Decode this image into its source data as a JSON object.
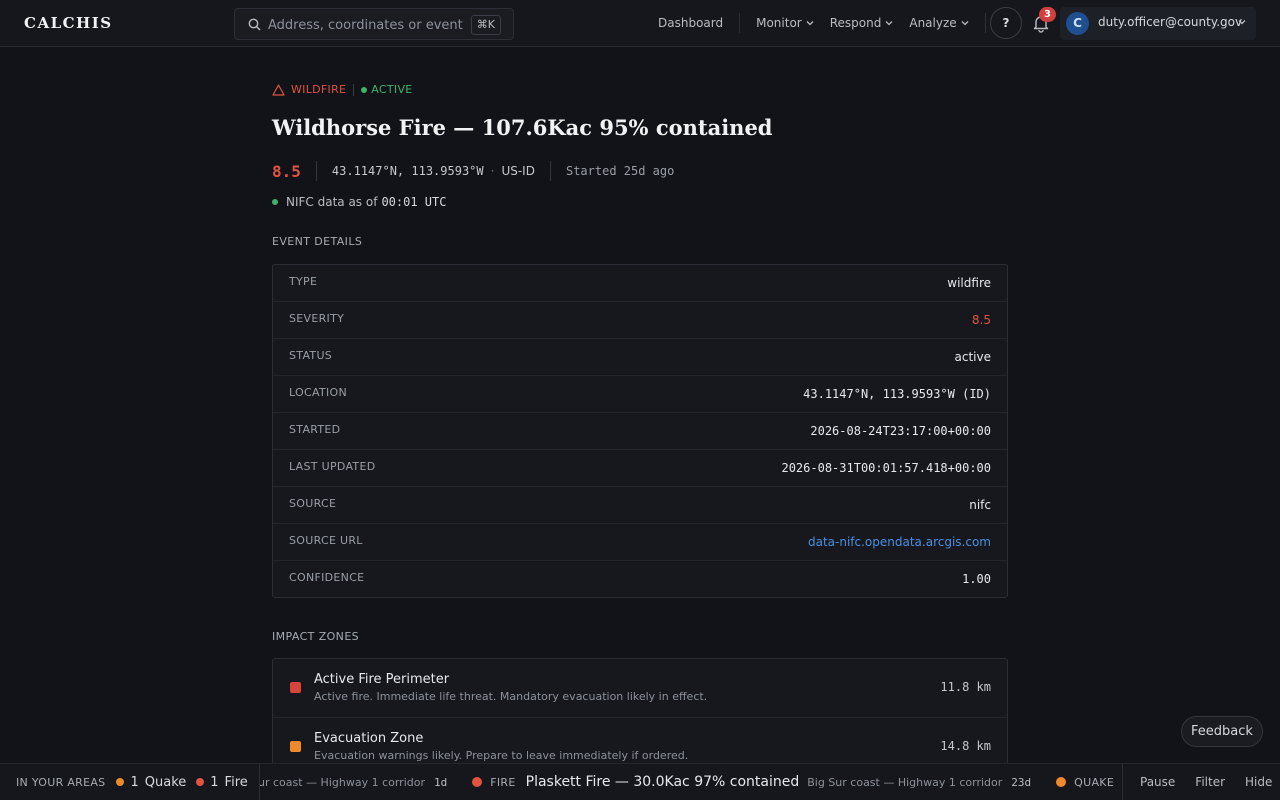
{
  "header": {
    "brand": "CALCHIS",
    "search": {
      "placeholder": "Address, coordinates or event",
      "shortcut": "⌘K"
    },
    "nav": [
      {
        "label": "Dashboard",
        "dropdown": false
      },
      {
        "label": "Monitor",
        "dropdown": true
      },
      {
        "label": "Respond",
        "dropdown": true
      },
      {
        "label": "Analyze",
        "dropdown": true
      }
    ],
    "help_label": "?",
    "notification_count": "3",
    "user": {
      "initial": "C",
      "email": "duty.officer@county.gov"
    }
  },
  "event": {
    "type_tag": "WILDFIRE",
    "status_tag": "ACTIVE",
    "title": "Wildhorse Fire — 107.6Kac 95% contained",
    "severity": "8.5",
    "coords": "43.1147°N, 113.9593°W",
    "region": "US-ID",
    "started": "Started 25d ago",
    "freshness_label": "NIFC data as of",
    "freshness_time": "00:01 UTC"
  },
  "details": {
    "section_label": "EVENT DETAILS",
    "rows": [
      {
        "key": "TYPE",
        "value": "wildfire",
        "style": ""
      },
      {
        "key": "SEVERITY",
        "value": "8.5",
        "style": "red"
      },
      {
        "key": "STATUS",
        "value": "active",
        "style": ""
      },
      {
        "key": "LOCATION",
        "value": "43.1147°N, 113.9593°W (ID)",
        "style": "mono"
      },
      {
        "key": "STARTED",
        "value": "2026-08-24T23:17:00+00:00",
        "style": "mono"
      },
      {
        "key": "LAST UPDATED",
        "value": "2026-08-31T00:01:57.418+00:00",
        "style": "mono"
      },
      {
        "key": "SOURCE",
        "value": "nifc",
        "style": ""
      },
      {
        "key": "SOURCE URL",
        "value": "data-nifc.opendata.arcgis.com",
        "style": "link"
      },
      {
        "key": "CONFIDENCE",
        "value": "1.00",
        "style": "mono"
      }
    ]
  },
  "zones": {
    "section_label": "IMPACT ZONES",
    "items": [
      {
        "name": "Active Fire Perimeter",
        "desc": "Active fire. Immediate life threat. Mandatory evacuation likely in effect.",
        "distance": "11.8 km",
        "color": "#d6443a"
      },
      {
        "name": "Evacuation Zone",
        "desc": "Evacuation warnings likely. Prepare to leave immediately if ordered.",
        "distance": "14.8 km",
        "color": "#ee8a2c"
      }
    ]
  },
  "feedback_label": "Feedback",
  "ticker": {
    "areas_label": "IN YOUR AREAS",
    "counts": [
      {
        "count": "1",
        "label": "Quake",
        "color": "#ee8a2c"
      },
      {
        "count": "1",
        "label": "Fire",
        "color": "#e0533f"
      }
    ],
    "lead_sub": "ur coast — Highway 1 corridor",
    "lead_age": "1d",
    "items": [
      {
        "type": "FIRE",
        "title": "Plaskett Fire — 30.0Kac 97% contained",
        "sub": "Big Sur coast — Highway 1 corridor",
        "age": "23d",
        "color": "#e0533f"
      },
      {
        "type": "QUAKE",
        "title": "",
        "sub": "",
        "age": "",
        "color": "#ee8a2c"
      }
    ],
    "actions": [
      "Pause",
      "Filter",
      "Hide"
    ]
  },
  "colors": {
    "accent_red": "#e0533f",
    "active_green": "#3fb36b",
    "link_blue": "#4a8fe0",
    "quake_orange": "#ee8a2c"
  }
}
